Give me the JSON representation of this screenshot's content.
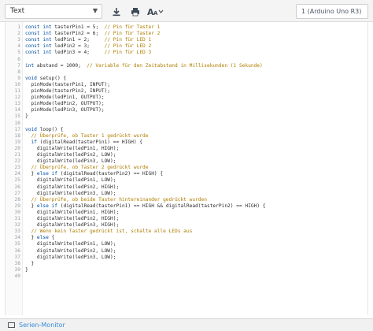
{
  "toolbar": {
    "mode_select": "Text",
    "board_select": "1 (Arduino Uno R3)",
    "icons": [
      "download-icon",
      "printer-icon",
      "font-size-icon"
    ]
  },
  "editor": {
    "lines": [
      {
        "n": "1",
        "code": "const int tasterPin1 = 5;  ",
        "comment": "// Pin für Taster 1"
      },
      {
        "n": "2",
        "code": "const int tasterPin2 = 6;  ",
        "comment": "// Pin für Taster 2"
      },
      {
        "n": "3",
        "code": "const int ledPin1 = 2;     ",
        "comment": "// Pin für LED 1"
      },
      {
        "n": "4",
        "code": "const int ledPin2 = 3;     ",
        "comment": "// Pin für LED 2"
      },
      {
        "n": "5",
        "code": "const int ledPin3 = 4;     ",
        "comment": "// Pin für LED 3"
      },
      {
        "n": "6",
        "code": "",
        "comment": ""
      },
      {
        "n": "7",
        "code": "int abstand = 1000;  ",
        "comment": "// Variable für den Zeitabstand in Millisekunden (1 Sekunde)"
      },
      {
        "n": "8",
        "code": "",
        "comment": ""
      },
      {
        "n": "9",
        "code": "void setup() {",
        "comment": ""
      },
      {
        "n": "10",
        "code": "  pinMode(tasterPin1, INPUT);",
        "comment": ""
      },
      {
        "n": "11",
        "code": "  pinMode(tasterPin2, INPUT);",
        "comment": ""
      },
      {
        "n": "12",
        "code": "  pinMode(ledPin1, OUTPUT);",
        "comment": ""
      },
      {
        "n": "13",
        "code": "  pinMode(ledPin2, OUTPUT);",
        "comment": ""
      },
      {
        "n": "14",
        "code": "  pinMode(ledPin3, OUTPUT);",
        "comment": ""
      },
      {
        "n": "15",
        "code": "}",
        "comment": ""
      },
      {
        "n": "16",
        "code": "",
        "comment": ""
      },
      {
        "n": "17",
        "code": "void loop() {",
        "comment": ""
      },
      {
        "n": "18",
        "code": "  ",
        "comment": "// Überprüfe, ob Taster 1 gedrückt wurde"
      },
      {
        "n": "19",
        "code": "  if (digitalRead(tasterPin1) == HIGH) {",
        "comment": ""
      },
      {
        "n": "20",
        "code": "    digitalWrite(ledPin1, HIGH);",
        "comment": ""
      },
      {
        "n": "21",
        "code": "    digitalWrite(ledPin2, LOW);",
        "comment": ""
      },
      {
        "n": "22",
        "code": "    digitalWrite(ledPin3, LOW);",
        "comment": ""
      },
      {
        "n": "23",
        "code": "  ",
        "comment": "// Überprüfe, ob Taster 2 gedrückt wurde"
      },
      {
        "n": "24",
        "code": "  } else if (digitalRead(tasterPin2) == HIGH) {",
        "comment": ""
      },
      {
        "n": "25",
        "code": "    digitalWrite(ledPin1, LOW);",
        "comment": ""
      },
      {
        "n": "26",
        "code": "    digitalWrite(ledPin2, HIGH);",
        "comment": ""
      },
      {
        "n": "27",
        "code": "    digitalWrite(ledPin3, LOW);",
        "comment": ""
      },
      {
        "n": "28",
        "code": "  ",
        "comment": "// Überprüfe, ob beide Taster hintereinander gedrückt wurden"
      },
      {
        "n": "29",
        "code": "  } else if (digitalRead(tasterPin1) == HIGH && digitalRead(tasterPin2) == HIGH) {",
        "comment": ""
      },
      {
        "n": "30",
        "code": "    digitalWrite(ledPin1, HIGH);",
        "comment": ""
      },
      {
        "n": "31",
        "code": "    digitalWrite(ledPin2, HIGH);",
        "comment": ""
      },
      {
        "n": "32",
        "code": "    digitalWrite(ledPin3, HIGH);",
        "comment": ""
      },
      {
        "n": "33",
        "code": "  ",
        "comment": "// Wenn kein Taster gedrückt ist, schalte alle LEDs aus"
      },
      {
        "n": "34",
        "code": "  } else {",
        "comment": ""
      },
      {
        "n": "35",
        "code": "    digitalWrite(ledPin1, LOW);",
        "comment": ""
      },
      {
        "n": "36",
        "code": "    digitalWrite(ledPin2, LOW);",
        "comment": ""
      },
      {
        "n": "37",
        "code": "    digitalWrite(ledPin3, LOW);",
        "comment": ""
      },
      {
        "n": "38",
        "code": "  }",
        "comment": ""
      },
      {
        "n": "39",
        "code": "}",
        "comment": ""
      },
      {
        "n": "40",
        "code": "",
        "comment": ""
      }
    ]
  },
  "statusbar": {
    "serial_monitor_label": "Serien-Monitor"
  },
  "colors": {
    "keyword": "#0050a0",
    "comment": "#b07d00",
    "link": "#3a8bd8"
  }
}
